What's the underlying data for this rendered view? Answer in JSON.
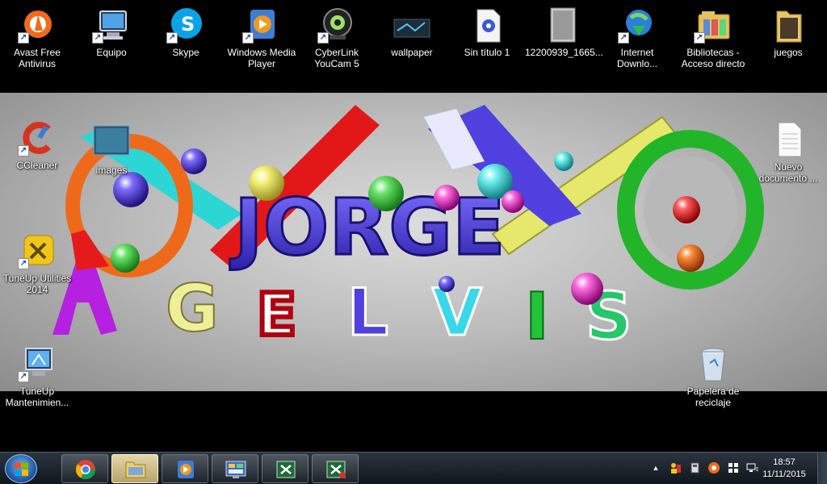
{
  "wallpaper": {
    "title_word": "JORGE",
    "letters": [
      "A",
      "G",
      "E",
      "L",
      "V",
      "I",
      "S"
    ]
  },
  "desktop_icons": [
    {
      "label": "Avast Free\nAntivirus",
      "icon": "avast-icon",
      "shortcut": true
    },
    {
      "label": "Equipo",
      "icon": "computer-icon",
      "shortcut": true
    },
    {
      "label": "Skype",
      "icon": "skype-icon",
      "shortcut": true
    },
    {
      "label": "Windows Media\nPlayer",
      "icon": "media-player-icon",
      "shortcut": true
    },
    {
      "label": "CyberLink\nYouCam 5",
      "icon": "webcam-icon",
      "shortcut": true
    },
    {
      "label": "wallpaper",
      "icon": "image-file-icon",
      "shortcut": false
    },
    {
      "label": "Sin título 1",
      "icon": "document-icon",
      "shortcut": false
    },
    {
      "label": "12200939_1665...",
      "icon": "photo-file-icon",
      "shortcut": false
    },
    {
      "label": "Internet\nDownlo...",
      "icon": "internet-download-manager-icon",
      "shortcut": true
    },
    {
      "label": "Bibliotecas -\nAcceso directo",
      "icon": "libraries-icon",
      "shortcut": true
    },
    {
      "label": "juegos",
      "icon": "folder-icon",
      "shortcut": false
    },
    {
      "label": "CCleaner",
      "icon": "ccleaner-icon",
      "shortcut": true
    },
    {
      "label": "images",
      "icon": "image-folder-icon",
      "shortcut": false
    },
    {
      "label": "TuneUp Utilities\n2014",
      "icon": "tuneup-utilities-icon",
      "shortcut": true
    },
    {
      "label": "TuneUp\nMantenimien...",
      "icon": "tuneup-maintenance-icon",
      "shortcut": true
    },
    {
      "label": "Nuevo\ndocumento ...",
      "icon": "text-document-icon",
      "shortcut": false
    },
    {
      "label": "Papelera de\nreciclaje",
      "icon": "recycle-bin-icon",
      "shortcut": false
    }
  ],
  "taskbar": {
    "pinned": [
      {
        "name": "chrome",
        "icon": "chrome-icon",
        "active": false
      },
      {
        "name": "explorer",
        "icon": "folder-icon",
        "active": true
      },
      {
        "name": "media-player",
        "icon": "media-player-icon",
        "active": false
      },
      {
        "name": "control-panel",
        "icon": "control-panel-icon",
        "active": false
      },
      {
        "name": "excel",
        "icon": "excel-icon",
        "active": false
      },
      {
        "name": "excel-2",
        "icon": "excel-icon",
        "active": false
      }
    ],
    "tray_icons": [
      "up-arrow-icon",
      "user-icon",
      "usb-icon",
      "avast-tray-icon",
      "windows-flag-icon",
      "network-icon"
    ],
    "tray_arrow": "▲",
    "clock": {
      "time": "18:57",
      "date": "11/11/2015"
    }
  },
  "colors": {
    "taskbar": "#1b232c",
    "jorge": "#4a3fd8"
  }
}
